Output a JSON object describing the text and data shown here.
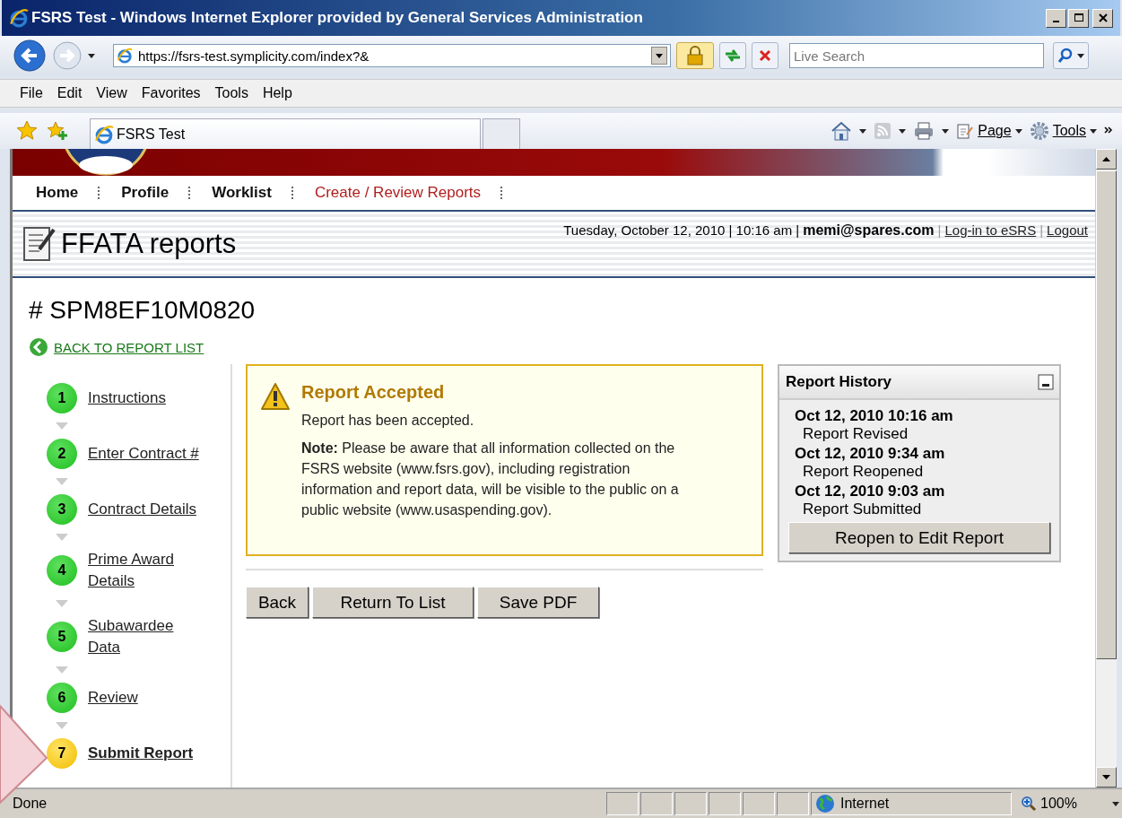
{
  "window": {
    "title": "FSRS Test - Windows Internet Explorer provided by General Services Administration"
  },
  "address_bar": {
    "url": "https://fsrs-test.symplicity.com/index?&"
  },
  "search": {
    "placeholder": "Live Search"
  },
  "menu": [
    "File",
    "Edit",
    "View",
    "Favorites",
    "Tools",
    "Help"
  ],
  "favorites_bar": {
    "tab": "FSRS Test",
    "commands": [
      "Page",
      "Tools"
    ]
  },
  "site_nav": [
    {
      "label": "Home",
      "selected": false
    },
    {
      "label": "Profile",
      "selected": false
    },
    {
      "label": "Worklist",
      "selected": false
    },
    {
      "label": "Create / Review Reports",
      "selected": true
    }
  ],
  "page_header": {
    "title": "FFATA reports",
    "date": "Tuesday, October 12, 2010 | 10:16 am |",
    "user": "memi@spares.com",
    "separator": "|",
    "links": [
      "Log-in to eSRS",
      "Logout"
    ]
  },
  "report": {
    "number": "# SPM8EF10M0820",
    "back_link": "BACK TO REPORT LIST"
  },
  "steps": [
    {
      "number": "1",
      "label": "Instructions",
      "current": false
    },
    {
      "number": "2",
      "label": "Enter Contract #",
      "current": false
    },
    {
      "number": "3",
      "label": "Contract Details",
      "current": false
    },
    {
      "number": "4",
      "label": "Prime Award Details",
      "current": false
    },
    {
      "number": "5",
      "label": "Subawardee Data",
      "current": false
    },
    {
      "number": "6",
      "label": "Review",
      "current": false
    },
    {
      "number": "7",
      "label": "Submit Report",
      "current": true
    }
  ],
  "alert": {
    "title": "Report Accepted",
    "message": "Report has been accepted.",
    "note": "**Note:** Please be aware that all information collected on the FSRS website (www.fsrs.gov), including registration information and report data, will be visible to the public on a public website (www.usaspending.gov)."
  },
  "buttons": [
    "Back",
    "Return To List",
    "Save PDF"
  ],
  "history": {
    "title": "Report History",
    "entries": [
      {
        "date": "Oct 12, 2010 10:16 am",
        "event": "Report Revised"
      },
      {
        "date": "Oct 12, 2010 9:34 am",
        "event": "Report Reopened"
      },
      {
        "date": "Oct 12, 2010 9:03 am",
        "event": "Report Submitted"
      }
    ],
    "button": "Reopen to Edit Report"
  },
  "status_bar": {
    "text": "Done",
    "zone": "Internet",
    "zoom": "100%"
  }
}
